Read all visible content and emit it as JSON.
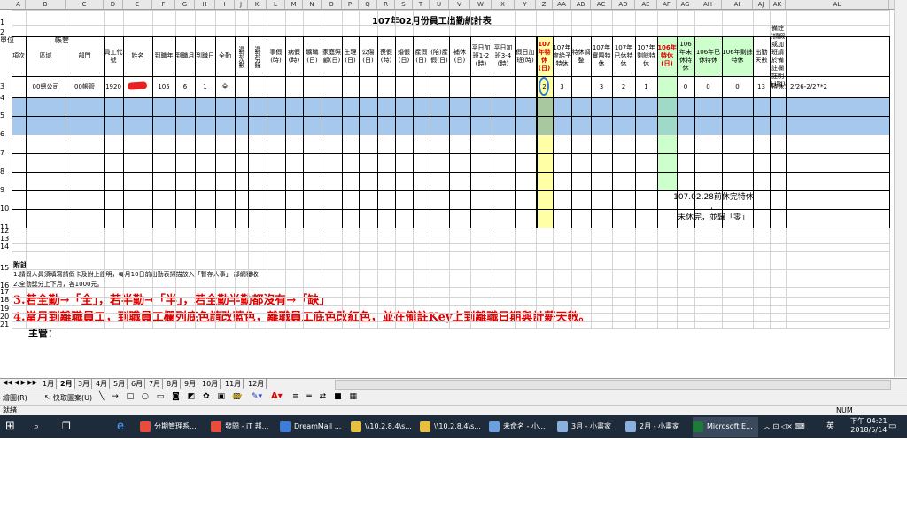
{
  "spreadsheet": {
    "columns": [
      "A",
      "B",
      "C",
      "D",
      "E",
      "F",
      "G",
      "H",
      "I",
      "J",
      "K",
      "L",
      "M",
      "N",
      "O",
      "P",
      "Q",
      "R",
      "S",
      "T",
      "U",
      "V",
      "W",
      "X",
      "Y",
      "Z",
      "AA",
      "AB",
      "AC",
      "AD",
      "AE",
      "AF",
      "AG",
      "AH",
      "AI",
      "AJ",
      "AK",
      "AL"
    ],
    "rows": [
      "1",
      "2",
      "3",
      "4",
      "5",
      "6",
      "7",
      "8",
      "9",
      "10",
      "11",
      "12",
      "13",
      "14",
      "15",
      "16",
      "17",
      "18",
      "19",
      "20",
      "21"
    ],
    "title": "107年02月份員工出勤統計表",
    "unit_label": "單位",
    "unit_value": "帳管",
    "headers": [
      "項次",
      "區域",
      "部門",
      "員工代號",
      "姓名",
      "到職年",
      "到職月",
      "到職日",
      "全勤",
      "遲到次數",
      "遲到分鐘",
      "事假(時)",
      "病假(時)",
      "曠職(日)",
      "家庭照顧(日)",
      "生理(日)",
      "公傷(日)",
      "喪假(時)",
      "婚假(日)",
      "產假(日)",
      "(陪)產假(日)",
      "補休(日)",
      "平日加班1-2(時)",
      "平日加班3-4(時)",
      "假日加班(時)",
      "107年特休(日)",
      "107年度給予特休",
      "特休調整",
      "107年實際特休",
      "107年已休特休",
      "107年剩餘特休",
      "106年特休(日)",
      "106年未休特休",
      "106年已休特休",
      "106年剩餘特休",
      "出勤天數",
      "備註\n(請假或加班請於備註欄註明日期)"
    ],
    "row4": {
      "area": "00總公司",
      "dept": "00帳管",
      "emp_id": "1920",
      "year": "105",
      "month": "6",
      "day": "1",
      "full_att": "全",
      "z": "2",
      "aa": "3",
      "ac": "3",
      "ad": "2",
      "ae": "1",
      "ag": "0",
      "ah": "0",
      "ai": "0",
      "aj": "13",
      "remark": "特休：2/26-2/27*2"
    },
    "callout_line1": "107.02.28前休完特休",
    "callout_line2": "，",
    "callout_line3": "未休完，並歸「零」",
    "notes_title": "附註",
    "note1": "1.請假人員須填寫請假卡及附上證明，每月10日前出勤表掃描放入「暫存人事」 部網覆收",
    "note2": "2.全勤獎分上下月，各1000元。",
    "note3": "3.若全勤→「全」，若半勤→「半」，若全勤半勤都沒有→「缺」",
    "note4": "4.當月到離職員工，到職員工欄列底色請改藍色，離職員工底色改紅色，並在備註Key上到離職日期與計薪天數。",
    "supervisor": "主管："
  },
  "sheet_tabs": [
    "1月",
    "2月",
    "3月",
    "4月",
    "5月",
    "6月",
    "7月",
    "8月",
    "9月",
    "10月",
    "11月",
    "12月"
  ],
  "drawing_toolbar": {
    "draw_label": "繪圖(R)",
    "autoshapes_label": "快取圖案(U)"
  },
  "status_bar": {
    "ready": "就緒",
    "num": "NUM"
  },
  "taskbar": {
    "items": [
      "分期管理系...",
      "發問 - iT 邦...",
      "DreamMail ...",
      "\\\\10.2.8.4\\s...",
      "\\\\10.2.8.4\\s...",
      "未命名 - 小...",
      "3月 - 小畫家",
      "2月 - 小畫家",
      "Microsoft E..."
    ],
    "ime": "英",
    "time": "下午 04:21",
    "date": "2018/5/14"
  },
  "colors": {
    "yellow": "#ffffa6",
    "green": "#ccffcc",
    "blue_row": "#a6c8ec",
    "red_text": "#e00000"
  }
}
